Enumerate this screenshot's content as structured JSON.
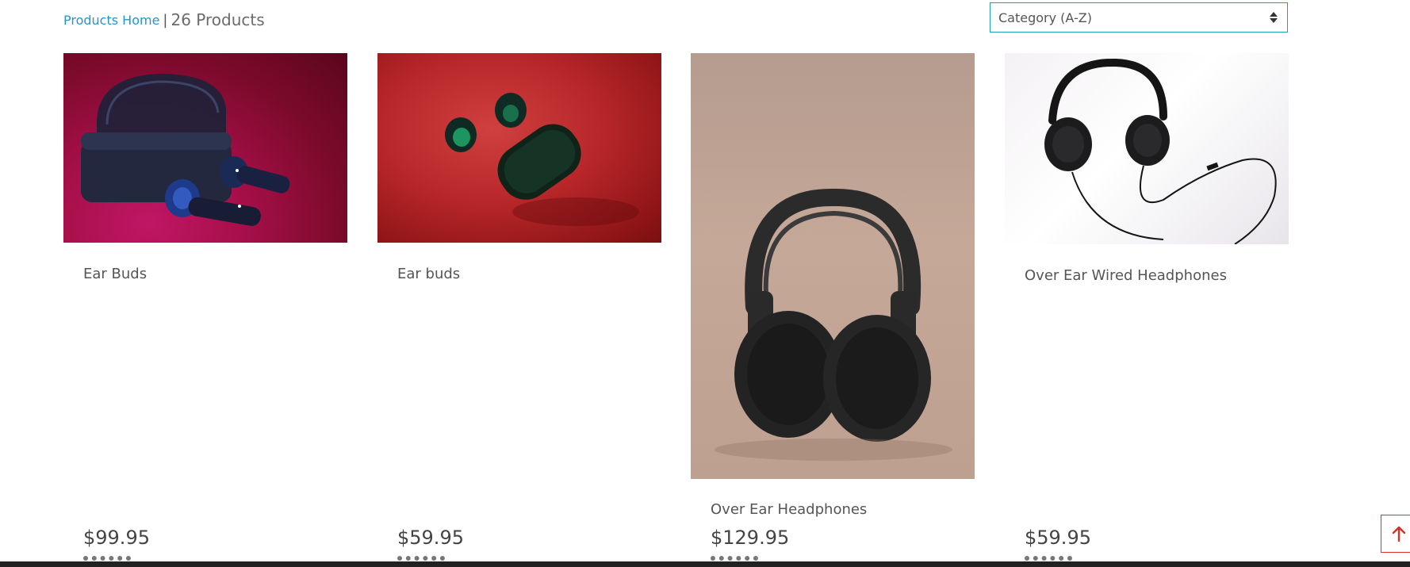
{
  "header": {
    "breadcrumb_link": "Products Home",
    "separator": "|",
    "product_count": "26 Products"
  },
  "sort": {
    "selected": "Category (A-Z)"
  },
  "products": [
    {
      "name": "Ear Buds",
      "price": "$99.95"
    },
    {
      "name": "Ear buds",
      "price": "$59.95"
    },
    {
      "name": "Over Ear Headphones",
      "price": "$129.95"
    },
    {
      "name": "Over Ear Wired Headphones",
      "price": "$59.95"
    }
  ],
  "icons": {
    "sort": "sort-arrows-icon",
    "scroll_top": "arrow-up-icon"
  },
  "colors": {
    "link": "#2196d3",
    "select_border": "#17a2b8",
    "scroll_top_accent": "#d93025"
  }
}
